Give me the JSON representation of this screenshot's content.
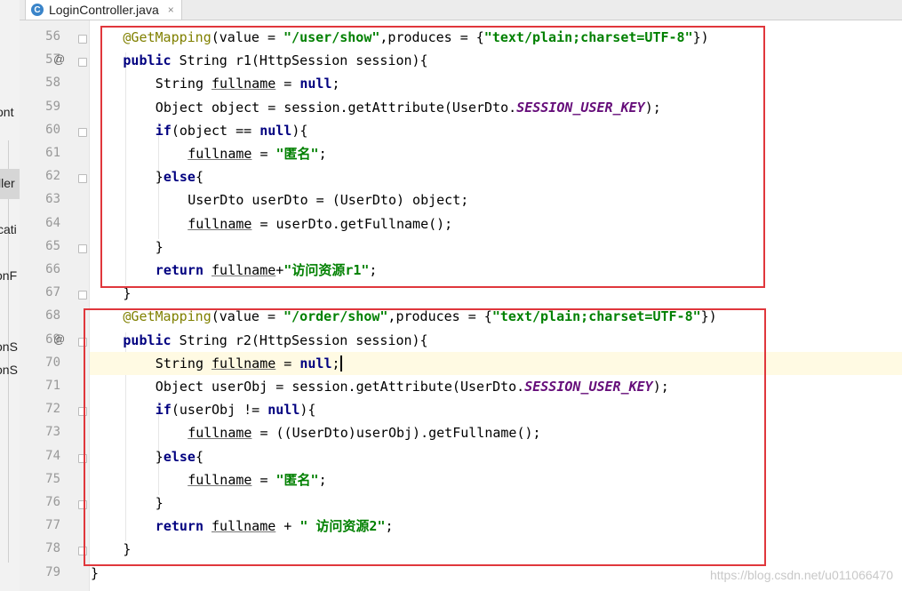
{
  "tab": {
    "title": "LoginController.java",
    "icon": "class-c-icon",
    "close": "×"
  },
  "left_panel_fragments": [
    "ont",
    "ller",
    "cati",
    "onF",
    "onS",
    "onS"
  ],
  "line_numbers": [
    "56",
    "57",
    "58",
    "59",
    "60",
    "61",
    "62",
    "63",
    "64",
    "65",
    "66",
    "67",
    "68",
    "69",
    "70",
    "71",
    "72",
    "73",
    "74",
    "75",
    "76",
    "77",
    "78",
    "79"
  ],
  "code_lines": [
    {
      "n": "56",
      "tokens": [
        [
          "ann",
          "@GetMapping"
        ],
        [
          "",
          "(value = "
        ],
        [
          "str",
          "\"/user/show\""
        ],
        [
          "",
          ",produces = {"
        ],
        [
          "str",
          "\"text/plain;charset=UTF-8\""
        ],
        [
          "",
          "})"
        ]
      ]
    },
    {
      "n": "57",
      "tokens": [
        [
          "kw",
          "public "
        ],
        [
          "",
          "String r1(HttpSession session){"
        ]
      ]
    },
    {
      "n": "58",
      "tokens": [
        [
          "",
          "String "
        ],
        [
          "var",
          "fullname"
        ],
        [
          "",
          " = "
        ],
        [
          "kw",
          "null"
        ],
        [
          "",
          ";"
        ]
      ]
    },
    {
      "n": "59",
      "tokens": [
        [
          "",
          "Object object = session.getAttribute(UserDto."
        ],
        [
          "fld",
          "SESSION_USER_KEY"
        ],
        [
          "",
          ");"
        ]
      ]
    },
    {
      "n": "60",
      "tokens": [
        [
          "kw",
          "if"
        ],
        [
          "",
          "(object == "
        ],
        [
          "kw",
          "null"
        ],
        [
          "",
          "){"
        ]
      ]
    },
    {
      "n": "61",
      "tokens": [
        [
          "var",
          "fullname"
        ],
        [
          "",
          " = "
        ],
        [
          "str",
          "\"匿名\""
        ],
        [
          "",
          ";"
        ]
      ]
    },
    {
      "n": "62",
      "tokens": [
        [
          "",
          "}"
        ],
        [
          "kw",
          "else"
        ],
        [
          "",
          "{"
        ]
      ]
    },
    {
      "n": "63",
      "tokens": [
        [
          "",
          "UserDto userDto = (UserDto) object;"
        ]
      ]
    },
    {
      "n": "64",
      "tokens": [
        [
          "var",
          "fullname"
        ],
        [
          "",
          " = userDto.getFullname();"
        ]
      ]
    },
    {
      "n": "65",
      "tokens": [
        [
          "",
          "}"
        ]
      ]
    },
    {
      "n": "66",
      "tokens": [
        [
          "kw",
          "return "
        ],
        [
          "var",
          "fullname"
        ],
        [
          "",
          "+"
        ],
        [
          "str",
          "\"访问资源r1\""
        ],
        [
          "",
          ";"
        ]
      ]
    },
    {
      "n": "67",
      "tokens": [
        [
          "",
          "}"
        ]
      ]
    },
    {
      "n": "68",
      "tokens": [
        [
          "ann",
          "@GetMapping"
        ],
        [
          "",
          "(value = "
        ],
        [
          "str",
          "\"/order/show\""
        ],
        [
          "",
          ",produces = {"
        ],
        [
          "str",
          "\"text/plain;charset=UTF-8\""
        ],
        [
          "",
          "})"
        ]
      ]
    },
    {
      "n": "69",
      "tokens": [
        [
          "kw",
          "public "
        ],
        [
          "",
          "String r2(HttpSession session){"
        ]
      ]
    },
    {
      "n": "70",
      "tokens": [
        [
          "",
          "String "
        ],
        [
          "var",
          "fullname"
        ],
        [
          "",
          " = "
        ],
        [
          "kw",
          "null"
        ],
        [
          "",
          ";"
        ]
      ]
    },
    {
      "n": "71",
      "tokens": [
        [
          "",
          "Object userObj = session.getAttribute(UserDto."
        ],
        [
          "fld",
          "SESSION_USER_KEY"
        ],
        [
          "",
          ");"
        ]
      ]
    },
    {
      "n": "72",
      "tokens": [
        [
          "kw",
          "if"
        ],
        [
          "",
          "(userObj != "
        ],
        [
          "kw",
          "null"
        ],
        [
          "",
          "){"
        ]
      ]
    },
    {
      "n": "73",
      "tokens": [
        [
          "var",
          "fullname"
        ],
        [
          "",
          " = ((UserDto)userObj).getFullname();"
        ]
      ]
    },
    {
      "n": "74",
      "tokens": [
        [
          "",
          "}"
        ],
        [
          "kw",
          "else"
        ],
        [
          "",
          "{"
        ]
      ]
    },
    {
      "n": "75",
      "tokens": [
        [
          "var",
          "fullname"
        ],
        [
          "",
          " = "
        ],
        [
          "str",
          "\"匿名\""
        ],
        [
          "",
          ";"
        ]
      ]
    },
    {
      "n": "76",
      "tokens": [
        [
          "",
          "}"
        ]
      ]
    },
    {
      "n": "77",
      "tokens": [
        [
          "kw",
          "return "
        ],
        [
          "var",
          "fullname"
        ],
        [
          "",
          " + "
        ],
        [
          "str",
          "\" 访问资源2\""
        ],
        [
          "",
          ";"
        ]
      ]
    },
    {
      "n": "78",
      "tokens": [
        [
          "",
          "}"
        ]
      ]
    },
    {
      "n": "79",
      "tokens": [
        [
          "",
          "}"
        ]
      ]
    }
  ],
  "override_marker": "@",
  "current_line": "70",
  "watermark": "https://blog.csdn.net/u011066470",
  "colors": {
    "keyword": "#000080",
    "string": "#008000",
    "annotation": "#808000",
    "static_field": "#660e7a",
    "highlight_box": "#e0373c"
  }
}
